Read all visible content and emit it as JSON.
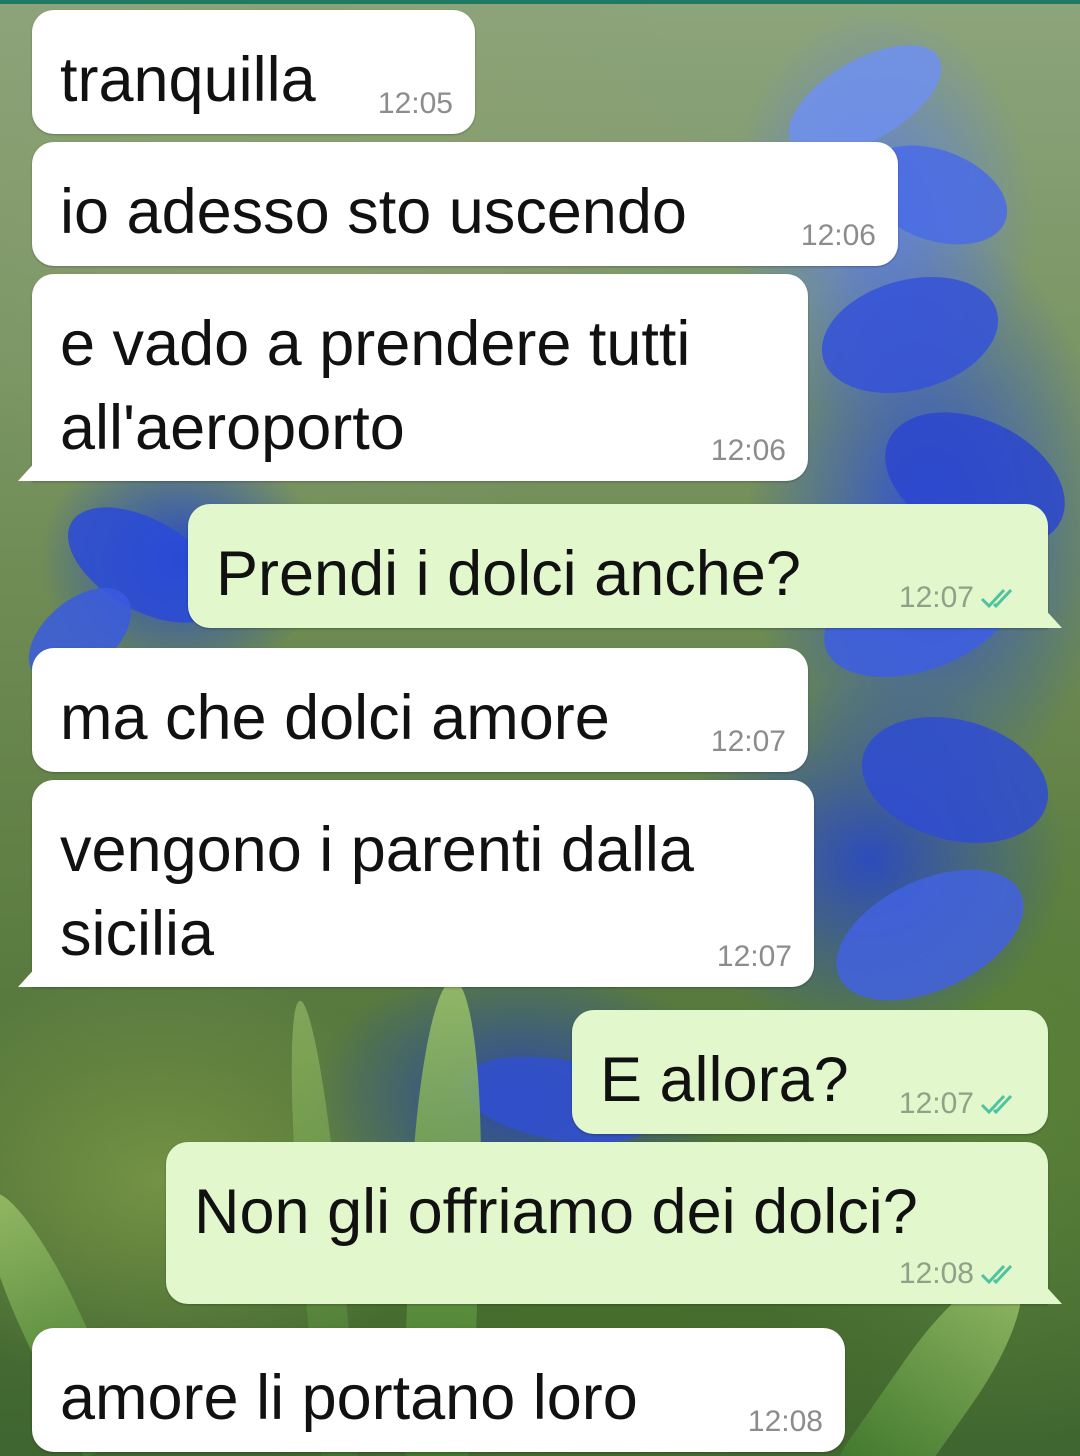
{
  "messages": [
    {
      "direction": "incoming",
      "text": "tranquilla",
      "time": "12:05"
    },
    {
      "direction": "incoming",
      "text": "io adesso sto uscendo",
      "time": "12:06"
    },
    {
      "direction": "incoming",
      "text": "e vado a prendere tutti\nall'aeroporto",
      "time": "12:06"
    },
    {
      "direction": "outgoing",
      "text": "Prendi i dolci anche?",
      "time": "12:07",
      "status": "read"
    },
    {
      "direction": "incoming",
      "text": "ma che dolci amore",
      "time": "12:07"
    },
    {
      "direction": "incoming",
      "text": "vengono i parenti dalla\nsicilia",
      "time": "12:07"
    },
    {
      "direction": "outgoing",
      "text": "E allora?",
      "time": "12:07",
      "status": "read"
    },
    {
      "direction": "outgoing",
      "text": "Non gli offriamo dei dolci?",
      "time": "12:08",
      "status": "read"
    },
    {
      "direction": "incoming",
      "text": "amore li portano loro",
      "time": "12:08"
    }
  ],
  "colors": {
    "incoming_bubble": "#ffffff",
    "outgoing_bubble": "#e2f7cb",
    "read_ticks": "#4fc3a1",
    "timestamp": "#8c8c8c"
  },
  "icons": {
    "read_receipt": "double-check-icon"
  }
}
